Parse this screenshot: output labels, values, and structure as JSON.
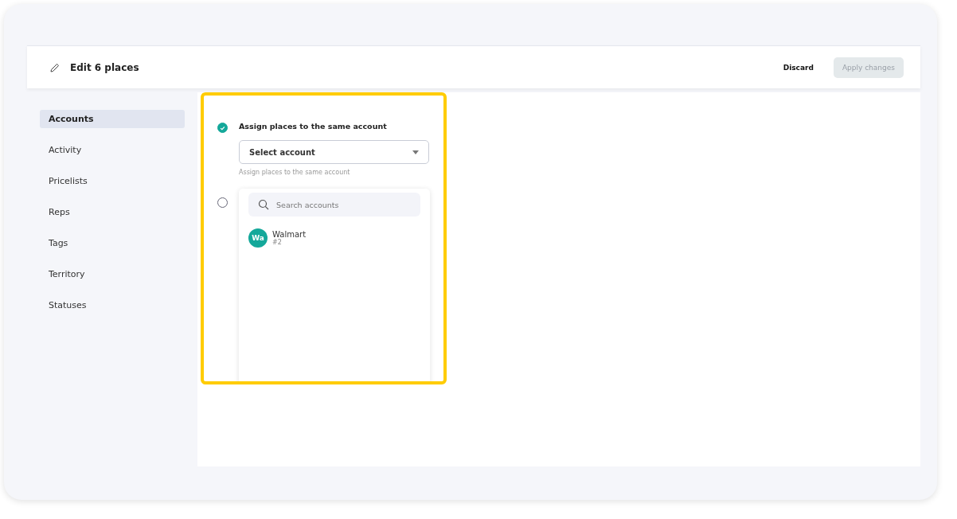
{
  "header": {
    "title": "Edit 6 places",
    "discard": "Discard",
    "apply": {
      "label": "Apply changes",
      "disabled": true
    }
  },
  "sidebar": {
    "items": [
      {
        "label": "Accounts",
        "selected": true
      },
      {
        "label": "Activity",
        "selected": false
      },
      {
        "label": "Pricelists",
        "selected": false
      },
      {
        "label": "Reps",
        "selected": false
      },
      {
        "label": "Tags",
        "selected": false
      },
      {
        "label": "Territory",
        "selected": false
      },
      {
        "label": "Statuses",
        "selected": false
      }
    ]
  },
  "options": [
    {
      "label": "Assign places to the same account",
      "selected": true
    },
    {
      "selected": false
    }
  ],
  "account_select": {
    "placeholder": "Select account",
    "helper": "Assign places to the same account"
  },
  "dropdown": {
    "search_placeholder": "Search accounts",
    "accounts": [
      {
        "initials": "Wa",
        "name": "Walmart",
        "number": "#2",
        "color": "#14a89a"
      }
    ]
  }
}
